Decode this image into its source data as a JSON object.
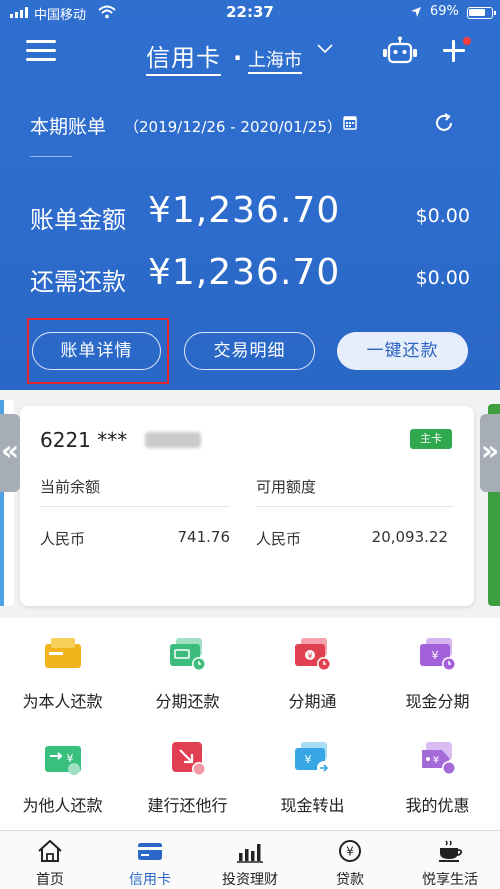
{
  "status_bar": {
    "carrier": "中国移动",
    "time": "22:37",
    "battery": "69%"
  },
  "nav": {
    "title": "信用卡",
    "city": "上海市"
  },
  "bill": {
    "period_label": "本期账单",
    "period_range": "（2019/12/26 - 2020/01/25）",
    "bill_amount_label": "账单金额",
    "bill_amount": "¥1,236.70",
    "bill_amount_usd": "$0.00",
    "due_label": "还需还款",
    "due_amount": "¥1,236.70",
    "due_amount_usd": "$0.00"
  },
  "actions": {
    "detail": "账单详情",
    "transactions": "交易明细",
    "repay": "一键还款"
  },
  "card": {
    "number_prefix": "6221 ***",
    "tag": "主卡",
    "balance_label": "当前余额",
    "credit_label": "可用额度",
    "currency": "人民币",
    "balance_value": "741.76",
    "credit_value": "20,093.22"
  },
  "functions": [
    {
      "label": "为本人还款",
      "icon": "self-repay-icon"
    },
    {
      "label": "分期还款",
      "icon": "installment-repay-icon"
    },
    {
      "label": "分期通",
      "icon": "installment-pass-icon"
    },
    {
      "label": "现金分期",
      "icon": "cash-installment-icon"
    },
    {
      "label": "为他人还款",
      "icon": "others-repay-icon"
    },
    {
      "label": "建行还他行",
      "icon": "ccb-repay-other-bank-icon"
    },
    {
      "label": "现金转出",
      "icon": "cash-transfer-out-icon"
    },
    {
      "label": "我的优惠",
      "icon": "my-offers-icon"
    }
  ],
  "tabs": [
    {
      "label": "首页",
      "icon": "home-icon"
    },
    {
      "label": "信用卡",
      "icon": "credit-card-icon"
    },
    {
      "label": "投资理财",
      "icon": "investment-chart-icon"
    },
    {
      "label": "贷款",
      "icon": "loan-yen-icon"
    },
    {
      "label": "悦享生活",
      "icon": "coffee-cup-icon"
    }
  ],
  "colors": {
    "brand_blue": "#2d6ccc",
    "tag_green": "#2fa84f",
    "highlight_red": "#e5262c"
  }
}
